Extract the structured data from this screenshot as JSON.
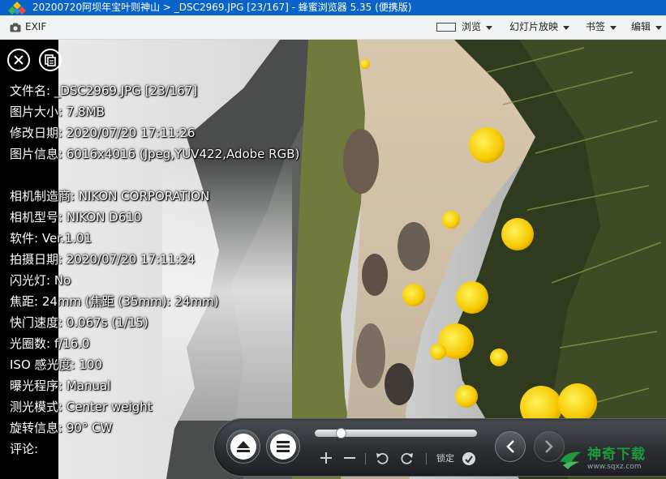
{
  "window": {
    "title": "20200720阿坝年宝叶则神山 > _DSC2969.JPG [23/167] - 蜂蜜浏览器 5.35 (便携版)"
  },
  "toolbar": {
    "exif_label": "EXIF",
    "browse_label": "浏览",
    "slideshow_label": "幻灯片放映",
    "bookmarks_label": "书签",
    "edit_label": "编辑"
  },
  "exif": [
    {
      "label": "文件名",
      "value": "_DSC2969.JPG [23/167]"
    },
    {
      "label": "图片大小",
      "value": "7.8MB"
    },
    {
      "label": "修改日期",
      "value": "2020/07/20 17:11:26"
    },
    {
      "label": "图片信息",
      "value": "6016x4016 (Jpeg,YUV422,Adobe RGB)"
    },
    {
      "label": "",
      "value": ""
    },
    {
      "label": "相机制造商",
      "value": "NIKON CORPORATION"
    },
    {
      "label": "相机型号",
      "value": "NIKON D610"
    },
    {
      "label": "软件",
      "value": "Ver.1.01"
    },
    {
      "label": "拍摄日期",
      "value": "2020/07/20 17:11:24"
    },
    {
      "label": "闪光灯",
      "value": "No"
    },
    {
      "label": "焦距",
      "value": "24mm (焦距 (35mm): 24mm)"
    },
    {
      "label": "快门速度",
      "value": "0.067s (1/15)"
    },
    {
      "label": "光圈数",
      "value": "f/16.0"
    },
    {
      "label": "ISO 感光度",
      "value": "100"
    },
    {
      "label": "曝光程序",
      "value": "Manual"
    },
    {
      "label": "测光模式",
      "value": "Center weight"
    },
    {
      "label": "旋转信息",
      "value": "90° CW"
    },
    {
      "label": "评论",
      "value": ""
    }
  ],
  "controls": {
    "lock_label": "锁定",
    "progress_fraction": 0.14
  },
  "watermark": {
    "title": "神奇下载",
    "sub": "www.sqxz.com"
  },
  "colors": {
    "titlebar": "#0a63c9",
    "toolbar": "#f1f2f4",
    "watermark_green": "#1c9a3c"
  }
}
